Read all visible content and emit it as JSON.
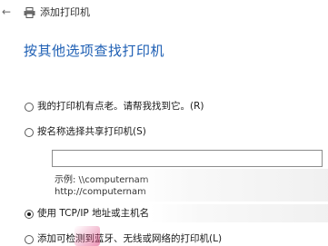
{
  "window": {
    "title": "添加打印机"
  },
  "icons": {
    "back": "back-arrow-icon",
    "printer": "printer-icon"
  },
  "page": {
    "heading": "按其他选项查找打印机"
  },
  "options": [
    {
      "label": "我的打印机有点老。请帮我找到它。(R)",
      "selected": false
    },
    {
      "label": "按名称选择共享打印机(S)",
      "selected": false
    },
    {
      "label": "使用 TCP/IP 地址或主机名",
      "selected": true
    },
    {
      "label": "添加可检测到蓝牙、无线或网络的打印机(L)",
      "selected": false
    }
  ],
  "share": {
    "input_value": "",
    "example_line1": "示例: \\\\computernam",
    "example_line2": "http://computernam"
  },
  "colors": {
    "heading": "#1e5fb4",
    "text": "#1a1a1a",
    "background": "#ffffff"
  }
}
